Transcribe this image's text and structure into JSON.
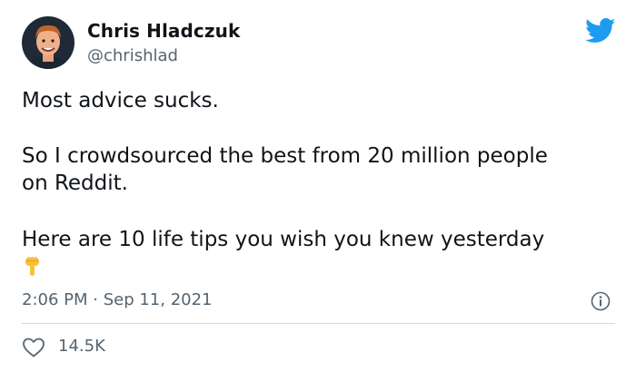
{
  "author": {
    "name": "Chris Hladczuk",
    "handle": "@chrishlad",
    "avatar_icon": "profile-avatar"
  },
  "brand": {
    "icon": "twitter-bird-icon",
    "color": "#1d9bf0"
  },
  "tweet": {
    "lines": [
      "Most advice sucks.",
      "So I crowdsourced the best from 20 million people",
      "on Reddit.",
      "Here are 10 life tips you wish you knew yesterday"
    ],
    "emoji": "backhand-index-pointing-down",
    "timestamp": "2:06 PM · Sep 11, 2021"
  },
  "actions": {
    "like_icon": "heart-icon",
    "like_count": "14.5K",
    "info_icon": "info-icon"
  },
  "colors": {
    "text": "#0f1419",
    "secondary": "#536471",
    "divider": "#cfd9de"
  }
}
